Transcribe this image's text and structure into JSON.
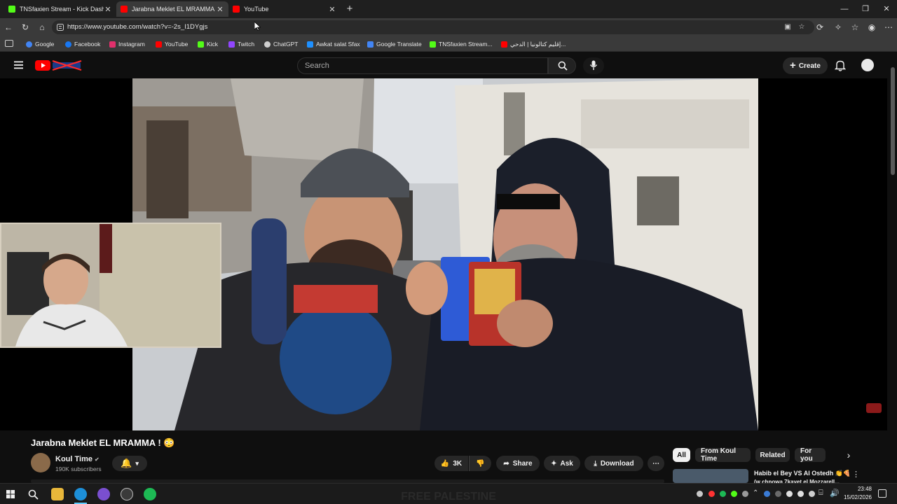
{
  "tabs": [
    {
      "label": "TNSfaxien Stream - Kick Dashboard",
      "icon": "kick-icon",
      "color": "#53fc18"
    },
    {
      "label": "Jarabna Meklet EL MRAMMA ! 😳",
      "icon": "youtube-icon",
      "color": "#ff0000"
    },
    {
      "label": "YouTube",
      "icon": "youtube-icon",
      "color": "#ff0000"
    }
  ],
  "address_bar": {
    "url": "https://www.youtube.com/watch?v=-2s_I1DYgjs"
  },
  "bookmarks": [
    {
      "label": "Google",
      "icon": "google-icon",
      "color": "#4285f4"
    },
    {
      "label": "Facebook",
      "icon": "facebook-icon",
      "color": "#1877f2"
    },
    {
      "label": "Instagram",
      "icon": "instagram-icon",
      "color": "#e1306c"
    },
    {
      "label": "YouTube",
      "icon": "youtube-icon",
      "color": "#ff0000"
    },
    {
      "label": "Kick",
      "icon": "kick-icon",
      "color": "#53fc18"
    },
    {
      "label": "Twitch",
      "icon": "twitch-icon",
      "color": "#9146ff"
    },
    {
      "label": "ChatGPT",
      "icon": "chatgpt-icon",
      "color": "#d0d0d0"
    },
    {
      "label": "Awkat salat Sfax",
      "icon": "prayer-times-icon",
      "color": "#1e90ff"
    },
    {
      "label": "Google Translate",
      "icon": "translate-icon",
      "color": "#4285f4"
    },
    {
      "label": "TNSfaxien Stream...",
      "icon": "kick-icon",
      "color": "#53fc18"
    },
    {
      "label": "إقليم كتالونيا | الدحي...",
      "icon": "youtube-icon",
      "color": "#ff0000"
    }
  ],
  "youtube": {
    "search_placeholder": "Search",
    "create_label": "Create",
    "video": {
      "title": "Jarabna Meklet EL MRAMMA ! 😳",
      "channel": "Koul Time",
      "subscribers": "190K subscribers",
      "likes": "3K",
      "share_label": "Share",
      "ask_label": "Ask",
      "download_label": "Download"
    },
    "chips": [
      "All",
      "From Koul Time",
      "Related",
      "For you"
    ],
    "next_video": {
      "title": "Habib el Bey VS Al Ostedh 👏🍕",
      "subtitle": "(w chnowa 7kayet el Mozzarell..."
    },
    "below_player_text": "FREE PALESTINE"
  },
  "taskbar": {
    "time": "23:48",
    "date": "15/02/2026"
  },
  "colors": {
    "youtube_red": "#ff0000",
    "accent": "#3ea6ff"
  }
}
